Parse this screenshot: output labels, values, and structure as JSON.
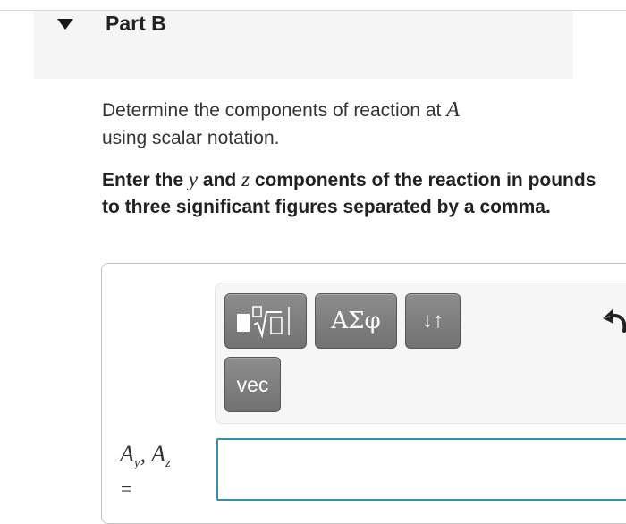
{
  "part": {
    "title": "Part B",
    "toggle_icon": "caret-down-icon"
  },
  "prompt": {
    "line1_text": "Determine the components of reaction at ",
    "line1_var": "A",
    "line2_text": "using scalar notation."
  },
  "instruction": {
    "pre": "Enter the ",
    "var_y": "y",
    "and": " and ",
    "var_z": "z",
    "post": " components of the reaction in pounds to three significant figures separated by a comma."
  },
  "toolbar": {
    "templates_icon": "templates-radical-icon",
    "greek_label": "ΑΣφ",
    "arrows_label": "↓↑",
    "vec_label": "vec",
    "undo_icon": "undo-icon"
  },
  "answer": {
    "var_a": "A",
    "sub_y": "y",
    "sep": ", ",
    "var_a2": "A",
    "sub_z": "z",
    "equals": "=",
    "value": ""
  },
  "colors": {
    "input_border": "#3a8ea6",
    "button_bg": "#7f7f7f",
    "header_bg": "#f5f5f5"
  }
}
